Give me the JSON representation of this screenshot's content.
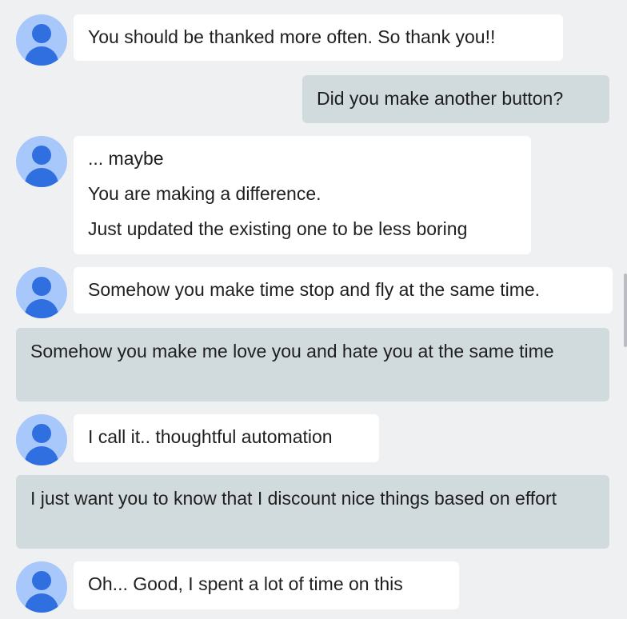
{
  "messages": [
    {
      "from": "bot",
      "lines": [
        "You should be thanked more often. So thank you!!"
      ]
    },
    {
      "from": "user",
      "text": "Did you make another button?"
    },
    {
      "from": "bot",
      "lines": [
        "... maybe",
        "You are making a difference.",
        "Just updated the existing one to be less boring"
      ]
    },
    {
      "from": "bot",
      "lines": [
        "Somehow you make time stop and fly at the same time."
      ]
    },
    {
      "from": "user",
      "text": "Somehow you make me love you and hate you at the same time"
    },
    {
      "from": "bot",
      "lines": [
        "I call it.. thoughtful automation"
      ]
    },
    {
      "from": "user",
      "text": "I just want you to know that I discount nice things based on effort"
    },
    {
      "from": "bot",
      "lines": [
        "Oh... Good, I spent a lot of time on this"
      ]
    }
  ],
  "colors": {
    "background": "#eef0f2",
    "bot_bubble": "#ffffff",
    "user_bubble": "#d1dadd",
    "avatar_bg": "#a8c7fa",
    "avatar_fg": "#2f6fe0"
  },
  "icons": {
    "avatar": "user-avatar-icon"
  }
}
